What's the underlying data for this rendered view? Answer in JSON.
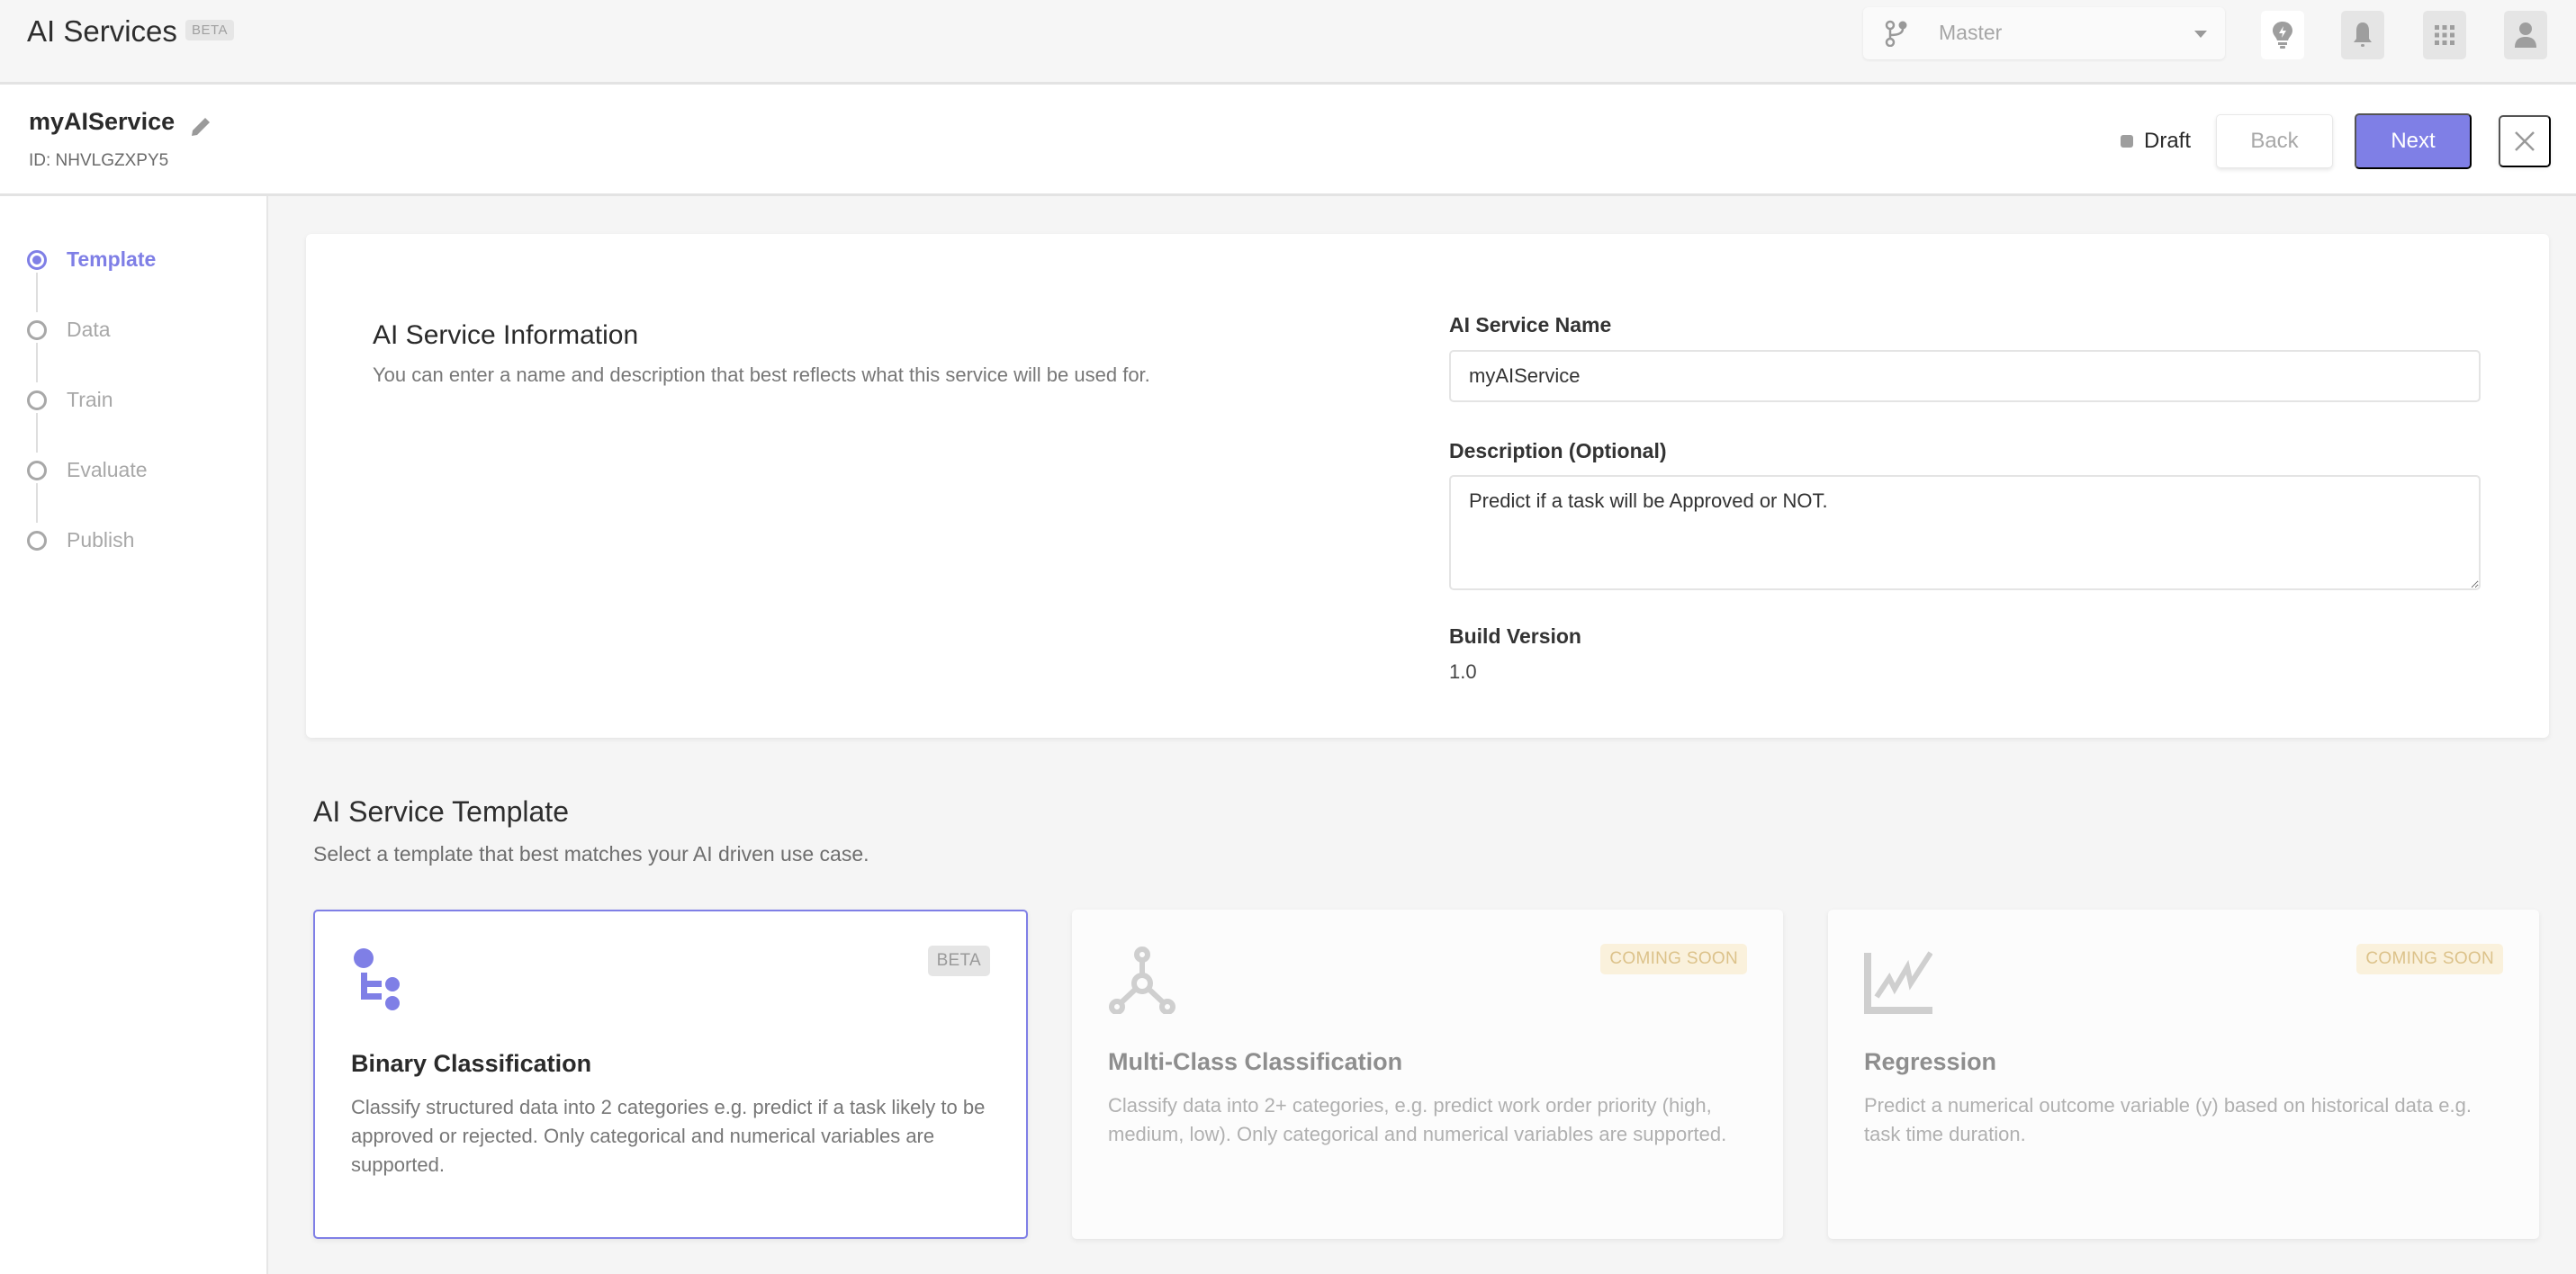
{
  "header": {
    "app_title": "AI Services",
    "app_badge": "BETA",
    "branch_select": {
      "value": "Master",
      "icon": "git-branch-icon"
    },
    "icons": [
      "lightbulb-icon",
      "bell-icon",
      "apps-grid-icon",
      "user-icon"
    ]
  },
  "subheader": {
    "service_name": "myAIService",
    "service_id": "ID: NHVLGZXPY5",
    "status": "Draft",
    "back_label": "Back",
    "next_label": "Next"
  },
  "sidebar": {
    "steps": [
      {
        "label": "Template",
        "active": true
      },
      {
        "label": "Data",
        "active": false
      },
      {
        "label": "Train",
        "active": false
      },
      {
        "label": "Evaluate",
        "active": false
      },
      {
        "label": "Publish",
        "active": false
      }
    ]
  },
  "info": {
    "title": "AI Service Information",
    "description": "You can enter a name and description that best reflects what this service will be used for.",
    "name_label": "AI Service Name",
    "name_value": "myAIService",
    "desc_label": "Description (Optional)",
    "desc_value": "Predict if a task will be Approved or NOT.",
    "version_label": "Build Version",
    "version_value": "1.0"
  },
  "templates": {
    "title": "AI Service Template",
    "subtitle": "Select a template that best matches your AI driven use case.",
    "items": [
      {
        "name": "Binary Classification",
        "badge": "BETA",
        "icon": "binary-classification-icon",
        "selected": true,
        "description": "Classify structured data into 2 categories e.g. predict if a task likely to be approved or rejected. Only categorical and numerical variables are supported."
      },
      {
        "name": "Multi-Class Classification",
        "badge": "COMING SOON",
        "icon": "multi-class-icon",
        "selected": false,
        "description": "Classify data into 2+ categories, e.g. predict work order priority (high, medium, low). Only categorical and numerical variables are supported."
      },
      {
        "name": "Regression",
        "badge": "COMING SOON",
        "icon": "regression-chart-icon",
        "selected": false,
        "description": "Predict a numerical outcome variable (y) based on historical data e.g. task time duration."
      }
    ]
  },
  "colors": {
    "accent": "#7f7fe6",
    "coming_soon_bg": "#faf1dc",
    "coming_soon_text": "#dcc28a"
  }
}
